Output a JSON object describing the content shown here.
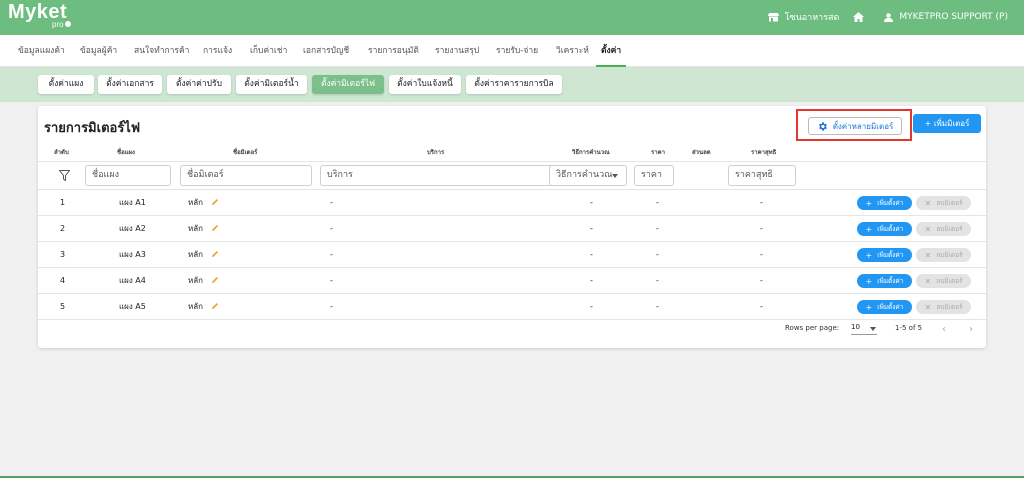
{
  "app": {
    "logo": "Myket",
    "logo_sub": "pro"
  },
  "topbar": {
    "store": "โซนอาหารสด",
    "user": "MYKETPRO SUPPORT (P)"
  },
  "menu": [
    "ข้อมูลแผงค้า",
    "ข้อมูลผู้ค้า",
    "สนใจทำการค้า",
    "การแจ้ง",
    "เก็บค่าเช่า",
    "เอกสารบัญชี",
    "รายการอนุมัติ",
    "รายงานสรุป",
    "รายรับ-จ่าย",
    "วิเคราะห์",
    "ตั้งค่า"
  ],
  "subtabs": [
    "ตั้งค่าแผง",
    "ตั้งค่าเอกสาร",
    "ตั้งค่าค่าปรับ",
    "ตั้งค่ามิเตอร์น้ำ",
    "ตั้งค่ามิเตอร์ไฟ",
    "ตั้งค่าใบแจ้งหนี้",
    "ตั้งค่าราคารายการบิล"
  ],
  "page": {
    "title": "รายการมิเตอร์ไฟ",
    "btn_multi": "ตั้งค่าหลายมิเตอร์",
    "btn_add": "+ เพิ่มมิเตอร์"
  },
  "table": {
    "headers": [
      "ลำดับ",
      "ชื่อแผง",
      "ชื่อมิเตอร์",
      "บริการ",
      "วิธีการคำนวณ",
      "ราคา",
      "ส่วนลด",
      "ราคาสุทธิ"
    ],
    "filters": {
      "stall": "ชื่อแผง",
      "meter": "ชื่อมิเตอร์",
      "service": "บริการ",
      "method": "วิธีการคำนวณ",
      "price": "ราคา",
      "net": "ราคาสุทธิ"
    },
    "rows": [
      {
        "no": "1",
        "stall": "แผง A1",
        "meter": "หลัก",
        "service": "-",
        "method": "-",
        "price": "-",
        "net": "-"
      },
      {
        "no": "2",
        "stall": "แผง A2",
        "meter": "หลัก",
        "service": "-",
        "method": "-",
        "price": "-",
        "net": "-"
      },
      {
        "no": "3",
        "stall": "แผง A3",
        "meter": "หลัก",
        "service": "-",
        "method": "-",
        "price": "-",
        "net": "-"
      },
      {
        "no": "4",
        "stall": "แผง A4",
        "meter": "หลัก",
        "service": "-",
        "method": "-",
        "price": "-",
        "net": "-"
      },
      {
        "no": "5",
        "stall": "แผง A5",
        "meter": "หลัก",
        "service": "-",
        "method": "-",
        "price": "-",
        "net": "-"
      }
    ],
    "row_btn_add": "เพิ่มตั้งค่า",
    "row_btn_del": "ลบมิเตอร์"
  },
  "pager": {
    "rows_label": "Rows per page:",
    "rows_value": "10",
    "range": "1-5 of 5"
  },
  "colors": {
    "green": "#6cbd7f",
    "light_green": "#cfe6d3",
    "blue": "#2196f3",
    "highlight": "#e0382f"
  }
}
